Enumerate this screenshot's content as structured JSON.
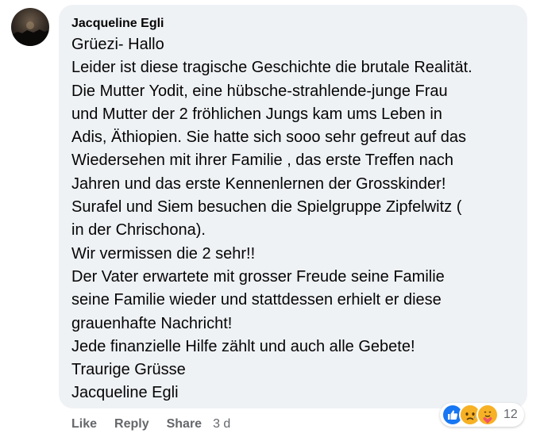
{
  "comment": {
    "author": "Jacqueline Egli",
    "lines": [
      "Grüezi- Hallo",
      "Leider ist diese tragische Geschichte die brutale Realität.",
      "Die Mutter Yodit, eine hübsche-strahlende-junge Frau",
      "und Mutter der 2 fröhlichen Jungs kam ums Leben in",
      "Adis, Äthiopien. Sie hatte sich sooo sehr gefreut auf das",
      "Wiedersehen mit ihrer Familie , das erste Treffen nach",
      "Jahren und das erste Kennenlernen der Grosskinder!",
      "Surafel und Siem besuchen die Spielgruppe Zipfelwitz (",
      "in der Chrischona).",
      "Wir vermissen die 2 sehr!!",
      "Der Vater erwartete mit grosser Freude seine Familie",
      "seine Familie wieder und stattdessen erhielt er diese",
      "grauenhafte Nachricht!",
      "Jede finanzielle Hilfe zählt und auch alle Gebete!",
      "Traurige Grüsse",
      "Jacqueline Egli"
    ]
  },
  "actions": {
    "like": "Like",
    "reply": "Reply",
    "share": "Share",
    "time": "3 d"
  },
  "reactions": {
    "icons": [
      "like-icon",
      "sad-icon",
      "care-icon"
    ],
    "count": "12"
  },
  "colors": {
    "bubble": "#eff2f5",
    "text": "#050505",
    "secondary": "#65676b",
    "like_blue": "#1877f2",
    "emoji_yellow": "#f7b125"
  }
}
